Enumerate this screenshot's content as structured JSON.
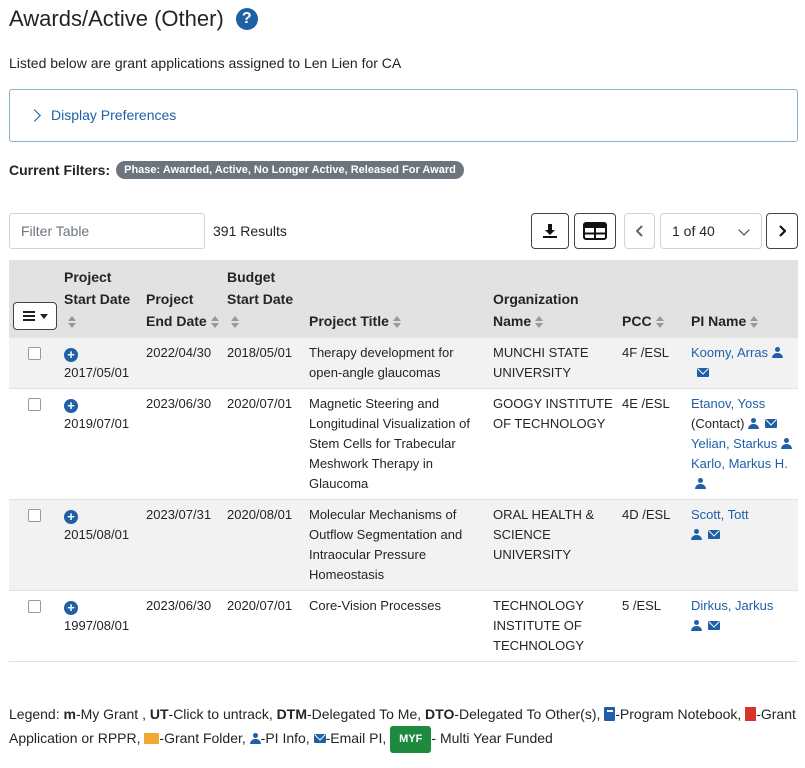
{
  "header": {
    "title": "Awards/Active (Other)",
    "help_icon": "question-circle-icon"
  },
  "intro": "Listed below are grant applications assigned to  Len Lien for CA",
  "preferences": {
    "label": "Display Preferences"
  },
  "filters": {
    "label": "Current Filters:",
    "badge": "Phase: Awarded, Active, No Longer Active, Released For Award"
  },
  "toolbar": {
    "filter_placeholder": "Filter Table",
    "results": "391 Results",
    "page_value": "1 of 40",
    "download_icon": "download-icon",
    "grid_icon": "table-layout-icon"
  },
  "table": {
    "headers": {
      "start": "Project Start Date",
      "end": "Project End Date",
      "budget": "Budget Start Date",
      "title": "Project Title",
      "org": "Organization Name",
      "pcc": "PCC",
      "pi": "PI Name"
    },
    "rows": [
      {
        "start": "2017/05/01",
        "end": "2022/04/30",
        "budget": "2018/05/01",
        "title": "Therapy development for open-angle glaucomas",
        "org": "MUNCHI STATE UNIVERSITY",
        "pcc": "4F /ESL",
        "pis": [
          {
            "name": "Koomy, Arras"
          }
        ]
      },
      {
        "start": "2019/07/01",
        "end": "2023/06/30",
        "budget": "2020/07/01",
        "title": "Magnetic Steering and Longitudinal Visualization of Stem Cells for Trabecular Meshwork Therapy in Glaucoma",
        "org": "GOOGY  INSTITUTE OF TECHNOLOGY",
        "pcc": "4E /ESL",
        "pis": [
          {
            "name": "Etanov,  Yoss",
            "note": "(Contact)"
          },
          {
            "name": "Yelian, Starkus"
          },
          {
            "name": "Karlo, Markus H."
          }
        ]
      },
      {
        "start": "2015/08/01",
        "end": "2023/07/31",
        "budget": "2020/08/01",
        "title": "Molecular Mechanisms of Outflow Segmentation and Intraocular Pressure Homeostasis",
        "org": "ORAL HEALTH & SCIENCE UNIVERSITY",
        "pcc": "4D /ESL",
        "pis": [
          {
            "name": "Scott, Tott"
          }
        ]
      },
      {
        "start": "1997/08/01",
        "end": "2023/06/30",
        "budget": "2020/07/01",
        "title": "Core-Vision Processes",
        "org": "TECHNOLOGY INSTITUTE OF TECHNOLOGY",
        "pcc": "5 /ESL",
        "pis": [
          {
            "name": "Dirkus, Jarkus"
          }
        ]
      }
    ]
  },
  "legend": {
    "prefix": "Legend: ",
    "m_key": "m",
    "m_text": "-My Grant , ",
    "ut_key": "UT",
    "ut_text": "-Click to untrack, ",
    "dtm_key": "DTM",
    "dtm_text": "-Delegated To Me, ",
    "dto_key": "DTO",
    "dto_text": "-Delegated To Other(s), ",
    "notebook_text": "-Program Notebook,",
    "pdf_text": "-Grant Application or RPPR, ",
    "folder_text": "-Grant Folder, ",
    "pi_text": "-PI Info, ",
    "email_text": "-Email PI, ",
    "myf_badge": "MYF",
    "myf_text": "- Multi Year Funded"
  }
}
